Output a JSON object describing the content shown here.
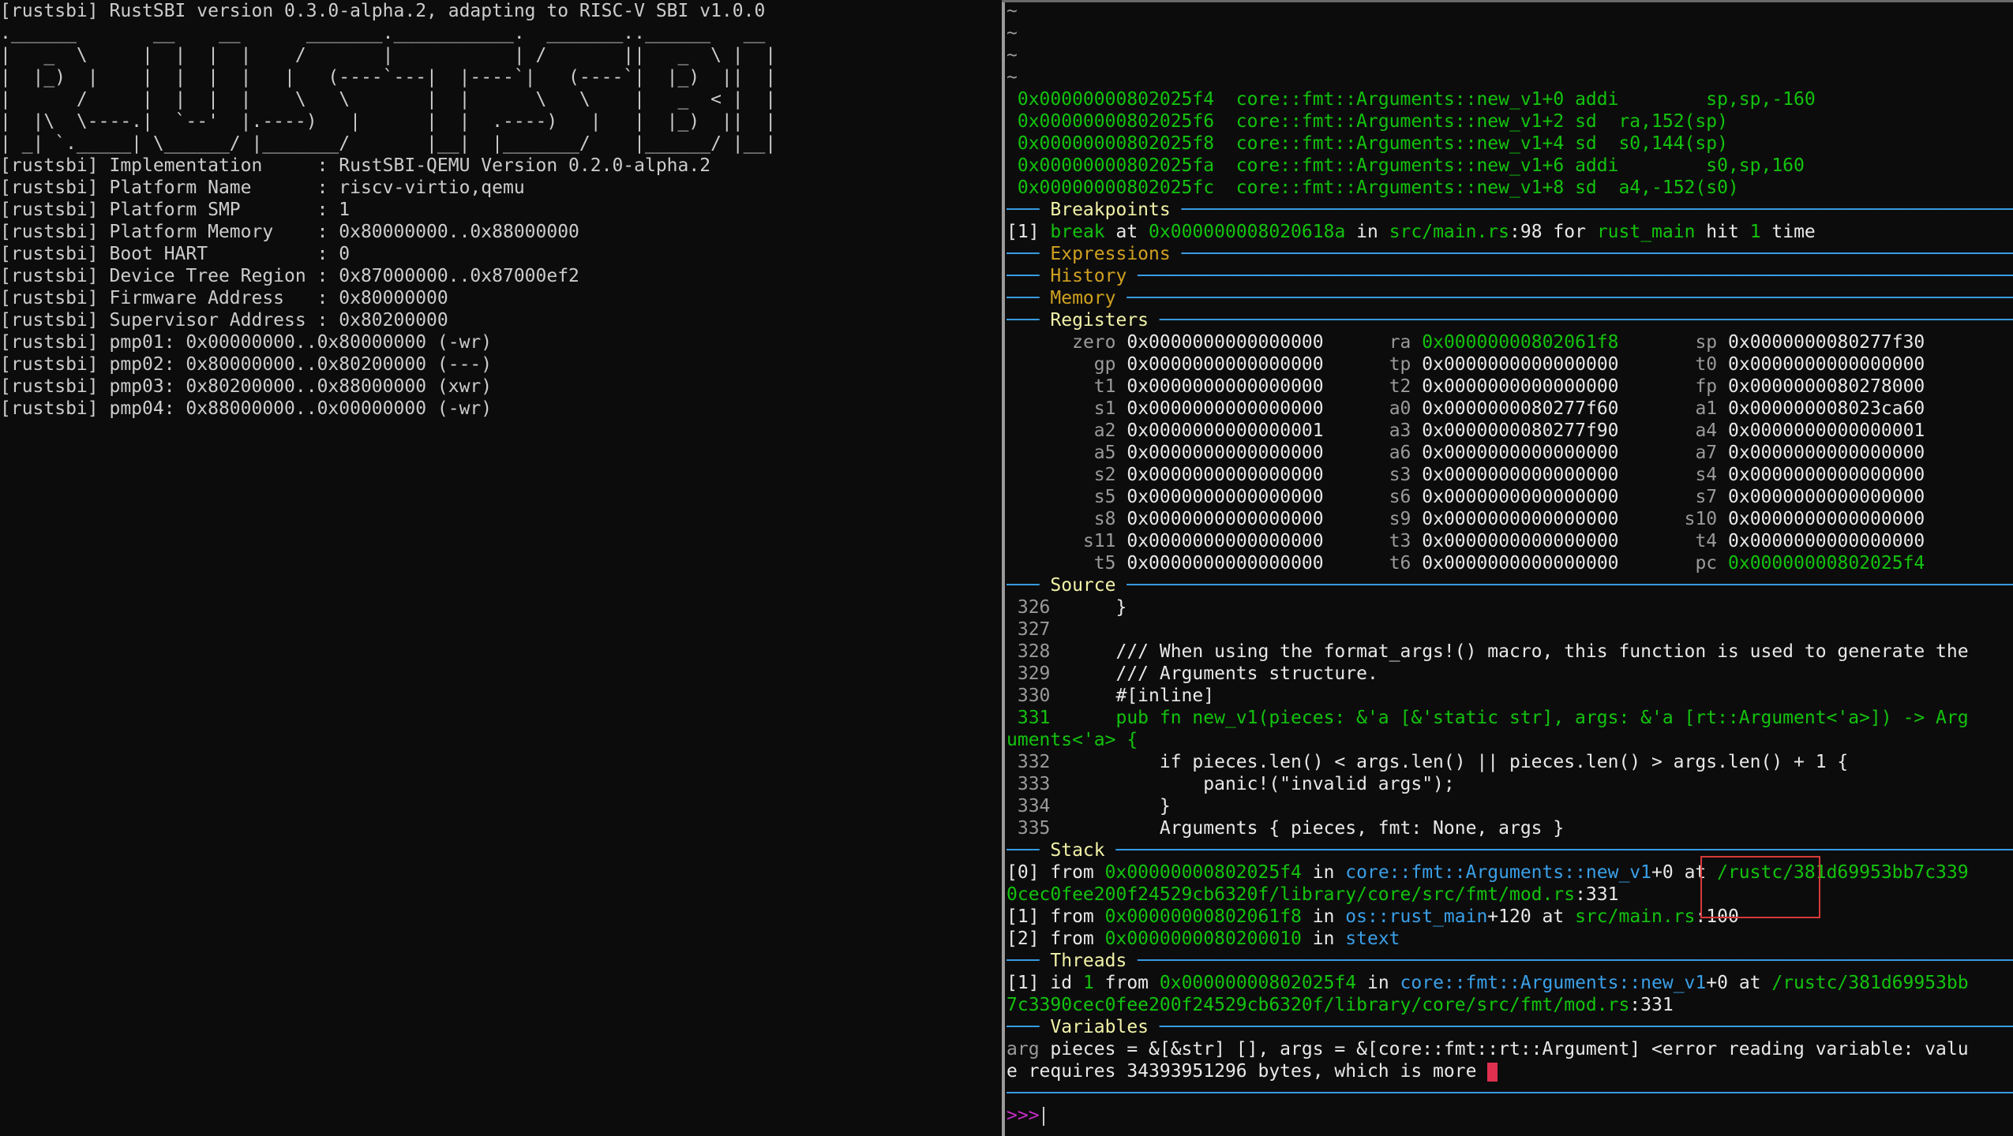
{
  "left_pane": {
    "lines": [
      "[rustsbi] RustSBI version 0.3.0-alpha.2, adapting to RISC-V SBI v1.0.0",
      ".______       __    __      _______.___________.  _______..______   __",
      "|   _  \\     |  |  |  |    /       |           | /       ||   _  \\ |  |",
      "|  |_)  |    |  |  |  |   |   (----`---|  |----`|   (----`|  |_)  ||  |",
      "|      /     |  |  |  |    \\   \\       |  |      \\   \\    |   _  < |  |",
      "|  |\\  \\----.|  `--'  |.----)   |      |  |  .----)   |   |  |_)  ||  |",
      "| _| `._____| \\______/ |_______/       |__|  |_______/    |______/ |__|",
      "[rustsbi] Implementation     : RustSBI-QEMU Version 0.2.0-alpha.2",
      "[rustsbi] Platform Name      : riscv-virtio,qemu",
      "[rustsbi] Platform SMP       : 1",
      "[rustsbi] Platform Memory    : 0x80000000..0x88000000",
      "[rustsbi] Boot HART          : 0",
      "[rustsbi] Device Tree Region : 0x87000000..0x87000ef2",
      "[rustsbi] Firmware Address   : 0x80000000",
      "[rustsbi] Supervisor Address : 0x80200000",
      "[rustsbi] pmp01: 0x00000000..0x80000000 (-wr)",
      "[rustsbi] pmp02: 0x80000000..0x80200000 (---)",
      "[rustsbi] pmp03: 0x80200000..0x88000000 (xwr)",
      "[rustsbi] pmp04: 0x88000000..0x00000000 (-wr)"
    ]
  },
  "right_pane": {
    "tildes": [
      "~",
      "~",
      "~",
      "~"
    ],
    "asm": [
      {
        "addr": " 0x00000000802025f4",
        "sym": "  core::fmt::Arguments::new_v1+0",
        "ins": " addi        sp,sp,-160"
      },
      {
        "addr": " 0x00000000802025f6",
        "sym": "  core::fmt::Arguments::new_v1+2",
        "ins": " sd  ra,152(sp)"
      },
      {
        "addr": " 0x00000000802025f8",
        "sym": "  core::fmt::Arguments::new_v1+4",
        "ins": " sd  s0,144(sp)"
      },
      {
        "addr": " 0x00000000802025fa",
        "sym": "  core::fmt::Arguments::new_v1+6",
        "ins": " addi        s0,sp,160"
      },
      {
        "addr": " 0x00000000802025fc",
        "sym": "  core::fmt::Arguments::new_v1+8",
        "ins": " sd  a4,-152(s0)"
      }
    ],
    "sections": {
      "breakpoints": "Breakpoints",
      "expressions": "Expressions",
      "history": "History",
      "memory": "Memory",
      "registers": "Registers",
      "source": "Source",
      "stack": "Stack",
      "threads": "Threads",
      "variables": "Variables"
    },
    "rule_prefix": "─── ",
    "rule_fill": " ─────────────────────────────────────────────────────────────────────────────────────────────────────────────────────────────────────────",
    "breakpoint": {
      "idx": "[1]",
      "kw": "break",
      "at": " at ",
      "addr": "0x000000008020618a",
      "in": " in ",
      "file": "src/main.rs",
      "line": ":98",
      "for": " for ",
      "fn": "rust_main",
      "hit": " hit ",
      "count": "1",
      "time": " time"
    },
    "registers": [
      [
        {
          "n": " zero",
          "v": "0x0000000000000000"
        },
        {
          "n": "ra",
          "v": "0x00000000802061f8",
          "hl": true
        },
        {
          "n": " sp",
          "v": "0x0000000080277f30"
        }
      ],
      [
        {
          "n": "   gp",
          "v": "0x0000000000000000"
        },
        {
          "n": "tp",
          "v": "0x0000000000000000"
        },
        {
          "n": " t0",
          "v": "0x0000000000000000"
        }
      ],
      [
        {
          "n": "   t1",
          "v": "0x0000000000000000"
        },
        {
          "n": "t2",
          "v": "0x0000000000000000"
        },
        {
          "n": " fp",
          "v": "0x0000000080278000"
        }
      ],
      [
        {
          "n": "   s1",
          "v": "0x0000000000000000"
        },
        {
          "n": "a0",
          "v": "0x0000000080277f60"
        },
        {
          "n": " a1",
          "v": "0x000000008023ca60"
        }
      ],
      [
        {
          "n": "   a2",
          "v": "0x0000000000000001"
        },
        {
          "n": "a3",
          "v": "0x0000000080277f90"
        },
        {
          "n": " a4",
          "v": "0x0000000000000001"
        }
      ],
      [
        {
          "n": "   a5",
          "v": "0x0000000000000000"
        },
        {
          "n": "a6",
          "v": "0x0000000000000000"
        },
        {
          "n": " a7",
          "v": "0x0000000000000000"
        }
      ],
      [
        {
          "n": "   s2",
          "v": "0x0000000000000000"
        },
        {
          "n": "s3",
          "v": "0x0000000000000000"
        },
        {
          "n": " s4",
          "v": "0x0000000000000000"
        }
      ],
      [
        {
          "n": "   s5",
          "v": "0x0000000000000000"
        },
        {
          "n": "s6",
          "v": "0x0000000000000000"
        },
        {
          "n": " s7",
          "v": "0x0000000000000000"
        }
      ],
      [
        {
          "n": "   s8",
          "v": "0x0000000000000000"
        },
        {
          "n": "s9",
          "v": "0x0000000000000000"
        },
        {
          "n": "s10",
          "v": "0x0000000000000000"
        }
      ],
      [
        {
          "n": "  s11",
          "v": "0x0000000000000000"
        },
        {
          "n": "t3",
          "v": "0x0000000000000000"
        },
        {
          "n": " t4",
          "v": "0x0000000000000000"
        }
      ],
      [
        {
          "n": "   t5",
          "v": "0x0000000000000000"
        },
        {
          "n": "t6",
          "v": "0x0000000000000000"
        },
        {
          "n": " pc",
          "v": "0x00000000802025f4",
          "hl": true
        }
      ]
    ],
    "source": [
      {
        "num": " 326",
        "code": "      }"
      },
      {
        "num": " 327",
        "code": ""
      },
      {
        "num": " 328",
        "code": "      /// When using the format_args!() macro, this function is used to generate the"
      },
      {
        "num": " 329",
        "code": "      /// Arguments structure."
      },
      {
        "num": " 330",
        "code": "      #[inline]"
      },
      {
        "num": " 331",
        "code": "      pub fn new_v1(pieces: &'a [&'static str], args: &'a [rt::Argument<'a>]) -> Arg",
        "current": true
      },
      {
        "num": "",
        "code": "uments<'a> {",
        "current": true
      },
      {
        "num": " 332",
        "code": "          if pieces.len() < args.len() || pieces.len() > args.len() + 1 {"
      },
      {
        "num": " 333",
        "code": "              panic!(\"invalid args\");"
      },
      {
        "num": " 334",
        "code": "          }"
      },
      {
        "num": " 335",
        "code": "          Arguments { pieces, fmt: None, args }"
      }
    ],
    "stack": [
      {
        "idx": "[0]",
        "from": " from ",
        "addr": "0x00000000802025f4",
        "in": " in ",
        "fn": "core::fmt::Arguments::new_v1",
        "off": "+0",
        "at": " at ",
        "path": "/rustc/381d69953bb7c339",
        "cont": "0cec0fee200f24529cb6320f/library/core/src/fmt/mod.rs",
        "line": ":331"
      },
      {
        "idx": "[1]",
        "from": " from ",
        "addr": "0x00000000802061f8",
        "in": " in ",
        "fn": "os::rust_main",
        "off": "+120",
        "at": " at ",
        "path": "src/main.rs",
        "line": ":100"
      },
      {
        "idx": "[2]",
        "from": " from ",
        "addr": "0x0000000080200010",
        "in": " in ",
        "fn": "stext"
      }
    ],
    "thread": {
      "idx": "[1]",
      "id": " id ",
      "num": "1",
      "from": " from ",
      "addr": "0x00000000802025f4",
      "in": " in ",
      "fn": "core::fmt::Arguments::new_v1",
      "off": "+0",
      "at": " at ",
      "path": "/rustc/381d69953bb",
      "cont": "7c3390cec0fee200f24529cb6320f/library/core/src/fmt/mod.rs",
      "line": ":331"
    },
    "variables": {
      "kind": "arg",
      "line1": " pieces = &[&str] [], args = &[core::fmt::rt::Argument] <error reading variable: valu",
      "line2": "e requires 34393951296 bytes, which is more "
    },
    "prompt": ">>>"
  },
  "colors": {
    "green": "#13c30e",
    "blue": "#3aa0e8",
    "yellow": "#f2f2a8",
    "gold": "#d0a020",
    "magenta": "#c62ec6",
    "highlight_box": "#d63a3a"
  }
}
